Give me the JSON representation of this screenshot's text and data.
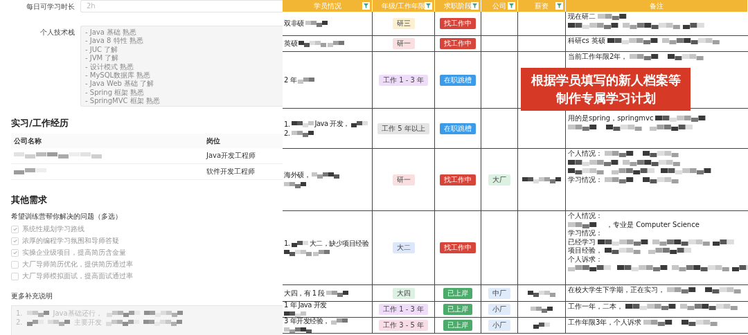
{
  "form": {
    "hours": {
      "label": "每日可学习时长",
      "value": "2h"
    },
    "stack": {
      "label": "个人技术栈",
      "lines": [
        "- Java 基础 熟悉",
        "- Java 8 特性 熟悉",
        "- JUC 了解",
        "- JVM 了解",
        "- 设计模式 熟悉",
        "- MySQL数据库 熟悉",
        "- Java Web 基础 了解",
        "- Spring 框架 熟悉",
        "- SpringMVC 框架 熟悉"
      ]
    },
    "experience": {
      "title": "实习/工作经历",
      "columns": [
        "公司名称",
        "岗位"
      ],
      "rows": [
        {
          "position": "Java开发工程师"
        },
        {
          "position": "软件开发工程师"
        }
      ]
    },
    "needs": {
      "title": "其他需求",
      "question": "希望训练营帮你解决的问题（多选）",
      "options": [
        {
          "label": "系统性规划学习路线",
          "checked": true
        },
        {
          "label": "浓厚的编程学习氛围和导师答疑",
          "checked": true
        },
        {
          "label": "实操企业级项目，提高简历含金量",
          "checked": true
        },
        {
          "label": "大厂导师简历优化，提供简历通过率",
          "checked": false
        },
        {
          "label": "大厂导师模拟面试，提高面试通过率",
          "checked": false
        }
      ],
      "notes_label": "更多补充说明",
      "notes": [
        [
          {
            "kind": "text",
            "text": "1."
          },
          {
            "kind": "mosaic"
          },
          {
            "kind": "text",
            "text": "Java基础还行，"
          },
          {
            "kind": "mosaic"
          },
          {
            "kind": "mosaic"
          }
        ],
        [
          {
            "kind": "text",
            "text": "2."
          },
          {
            "kind": "mosaic"
          },
          {
            "kind": "mosaic"
          },
          {
            "kind": "text",
            "text": "主要开发"
          },
          {
            "kind": "mosaic"
          },
          {
            "kind": "mosaic"
          }
        ]
      ]
    }
  },
  "sheet": {
    "columns": [
      {
        "label": "学员情况",
        "filter": true
      },
      {
        "label": "年级/工作年限",
        "filter": true
      },
      {
        "label": "求职阶段",
        "filter": true
      },
      {
        "label": "公司",
        "filter": true
      },
      {
        "label": "薪资",
        "filter": true
      },
      {
        "label": "备注",
        "filter": false
      }
    ],
    "rows": [
      {
        "info": [
          [
            {
              "kind": "text",
              "text": "双非硕"
            },
            {
              "kind": "mosaic"
            }
          ]
        ],
        "grade": {
          "label": "研三",
          "color": "#fbf0cf"
        },
        "stage": {
          "label": "找工作中",
          "color": "#d6443a"
        },
        "remarks": [
          [
            {
              "kind": "text",
              "text": "现在研二"
            },
            {
              "kind": "mosaic"
            }
          ],
          [
            {
              "kind": "mosaic"
            },
            {
              "kind": "mosaic"
            },
            {
              "kind": "mosaic"
            }
          ]
        ]
      },
      {
        "info": [
          [
            {
              "kind": "text",
              "text": "英硕"
            },
            {
              "kind": "mosaic"
            },
            {
              "kind": "mosaic"
            }
          ]
        ],
        "grade": {
          "label": "研一",
          "color": "#f9dfdf"
        },
        "stage": {
          "label": "找工作中",
          "color": "#d6443a"
        },
        "remarks": [
          [
            {
              "kind": "text",
              "text": "科研cs 英硕"
            },
            {
              "kind": "mosaic"
            },
            {
              "kind": "mosaic"
            }
          ]
        ]
      },
      {
        "info": [
          [
            {
              "kind": "text",
              "text": "2 年"
            },
            {
              "kind": "mosaic"
            }
          ]
        ],
        "grade": {
          "label": "工作 1 - 3 年",
          "color": "#efdcf8"
        },
        "stage": {
          "label": "在职跳槽",
          "color": "#3c9be8"
        },
        "remarks": [
          [
            {
              "kind": "text",
              "text": "当前工作年限2年，"
            },
            {
              "kind": "mosaic"
            },
            {
              "kind": "mosaic"
            }
          ]
        ]
      },
      {
        "info": [
          [
            {
              "kind": "text",
              "text": "1."
            },
            {
              "kind": "mosaic"
            },
            {
              "kind": "text",
              "text": "Java 开发，"
            },
            {
              "kind": "mosaic"
            }
          ],
          [
            {
              "kind": "text",
              "text": "2."
            },
            {
              "kind": "mosaic"
            }
          ]
        ],
        "grade": {
          "label": "工作 5 年以上",
          "color": "#e4e4e4"
        },
        "stage": {
          "label": "在职跳槽",
          "color": "#3c9be8"
        },
        "remarks": [
          [
            {
              "kind": "text",
              "text": "用的是spring，springmvc"
            },
            {
              "kind": "mosaic"
            }
          ],
          [
            {
              "kind": "mosaic"
            },
            {
              "kind": "mosaic"
            },
            {
              "kind": "mosaic"
            }
          ]
        ]
      },
      {
        "info": [
          [
            {
              "kind": "text",
              "text": "海外硕，"
            },
            {
              "kind": "mosaic"
            }
          ],
          [
            {
              "kind": "mosaic"
            }
          ]
        ],
        "grade": {
          "label": "研一",
          "color": "#f9dfdf"
        },
        "stage": {
          "label": "找工作中",
          "color": "#d6443a"
        },
        "company": {
          "label": "大厂",
          "color": "#dcf1e2"
        },
        "salary": [
          [
            {
              "kind": "mosaic"
            }
          ]
        ],
        "remarks": [
          [
            {
              "kind": "text",
              "text": "个人情况："
            },
            {
              "kind": "mosaic"
            },
            {
              "kind": "mosaic"
            }
          ],
          [
            {
              "kind": "mosaic"
            },
            {
              "kind": "mosaic"
            }
          ],
          [
            {
              "kind": "mosaic"
            },
            {
              "kind": "mosaic"
            },
            {
              "kind": "mosaic"
            }
          ],
          [
            {
              "kind": "text",
              "text": "学习情况："
            },
            {
              "kind": "mosaic"
            },
            {
              "kind": "mosaic"
            }
          ]
        ]
      },
      {
        "info": [
          [
            {
              "kind": "text",
              "text": "1."
            },
            {
              "kind": "mosaic"
            },
            {
              "kind": "text",
              "text": "大二，缺少项目经验"
            }
          ],
          [
            {
              "kind": "mosaic"
            },
            {
              "kind": "mosaic"
            }
          ]
        ],
        "grade": {
          "label": "大二",
          "color": "#dde7fb"
        },
        "stage": {
          "label": "找工作中",
          "color": "#d6443a"
        },
        "remarks": [
          [
            {
              "kind": "text",
              "text": "个人情况："
            }
          ],
          [
            {
              "kind": "mosaic"
            },
            {
              "kind": "text",
              "text": "，专业是 Computer Science"
            }
          ],
          [
            {
              "kind": "text",
              "text": "学习情况："
            }
          ],
          [
            {
              "kind": "text",
              "text": "已经学习"
            },
            {
              "kind": "mosaic"
            },
            {
              "kind": "mosaic"
            },
            {
              "kind": "mosaic"
            }
          ],
          [
            {
              "kind": "text",
              "text": "项目经验，"
            },
            {
              "kind": "mosaic"
            },
            {
              "kind": "mosaic"
            }
          ],
          [
            {
              "kind": "text",
              "text": "个人诉求："
            }
          ],
          [
            {
              "kind": "mosaic"
            },
            {
              "kind": "mosaic"
            },
            {
              "kind": "mosaic"
            },
            {
              "kind": "mosaic"
            }
          ]
        ]
      },
      {
        "info": [
          [
            {
              "kind": "text",
              "text": "大四，有 1 段"
            },
            {
              "kind": "mosaic"
            }
          ]
        ],
        "grade": {
          "label": "大四",
          "color": "#dcf1e2"
        },
        "stage": {
          "label": "已上岸",
          "color": "#4caa6a"
        },
        "company": {
          "label": "中厂",
          "color": "#dfeafb"
        },
        "salary": [
          [
            {
              "kind": "mosaic"
            }
          ]
        ],
        "remarks": [
          [
            {
              "kind": "text",
              "text": "在校大学生下学期，正在实习，"
            },
            {
              "kind": "mosaic"
            },
            {
              "kind": "mosaic"
            }
          ]
        ]
      },
      {
        "info": [
          [
            {
              "kind": "text",
              "text": "1 年 Java 开发"
            }
          ],
          [
            {
              "kind": "mosaic"
            }
          ]
        ],
        "grade": {
          "label": "工作 1 - 3 年",
          "color": "#efdcf8"
        },
        "stage": {
          "label": "已上岸",
          "color": "#4caa6a"
        },
        "company": {
          "label": "小厂",
          "color": "#dfeafb"
        },
        "salary": [
          [
            {
              "kind": "mosaic"
            }
          ]
        ],
        "remarks": [
          [
            {
              "kind": "text",
              "text": "工作一年，二本，"
            },
            {
              "kind": "mosaic"
            },
            {
              "kind": "mosaic"
            }
          ]
        ]
      },
      {
        "info": [
          [
            {
              "kind": "text",
              "text": "3 年开发经验，"
            },
            {
              "kind": "mosaic"
            }
          ],
          [
            {
              "kind": "mosaic"
            }
          ]
        ],
        "grade": {
          "label": "工作 3 - 5 年",
          "color": "#f8dde6"
        },
        "stage": {
          "label": "已上岸",
          "color": "#4caa6a"
        },
        "company": {
          "label": "小厂",
          "color": "#dfeafb"
        },
        "salary": [
          [
            {
              "kind": "mosaic"
            }
          ]
        ],
        "remarks": [
          [
            {
              "kind": "text",
              "text": "工作年限3年，个人诉求"
            },
            {
              "kind": "mosaic"
            },
            {
              "kind": "mosaic"
            }
          ]
        ]
      }
    ]
  },
  "banner": {
    "lines": [
      "根据学员填写的新人档案等",
      "制作专属学习计划"
    ]
  }
}
